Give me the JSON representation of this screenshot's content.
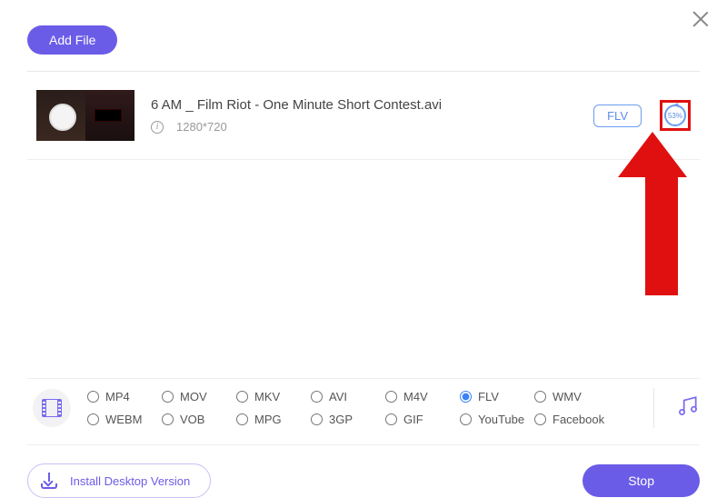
{
  "header": {
    "add_file_label": "Add File"
  },
  "file": {
    "title": "6 AM _ Film Riot - One Minute Short Contest.avi",
    "resolution": "1280*720",
    "format_tag": "FLV",
    "progress": "53%"
  },
  "formats": {
    "row1": [
      "MP4",
      "MOV",
      "MKV",
      "AVI",
      "M4V",
      "FLV",
      "WMV"
    ],
    "row2": [
      "WEBM",
      "VOB",
      "MPG",
      "3GP",
      "GIF",
      "YouTube",
      "Facebook"
    ],
    "selected": "FLV"
  },
  "footer": {
    "install_label": "Install Desktop Version",
    "stop_label": "Stop"
  }
}
